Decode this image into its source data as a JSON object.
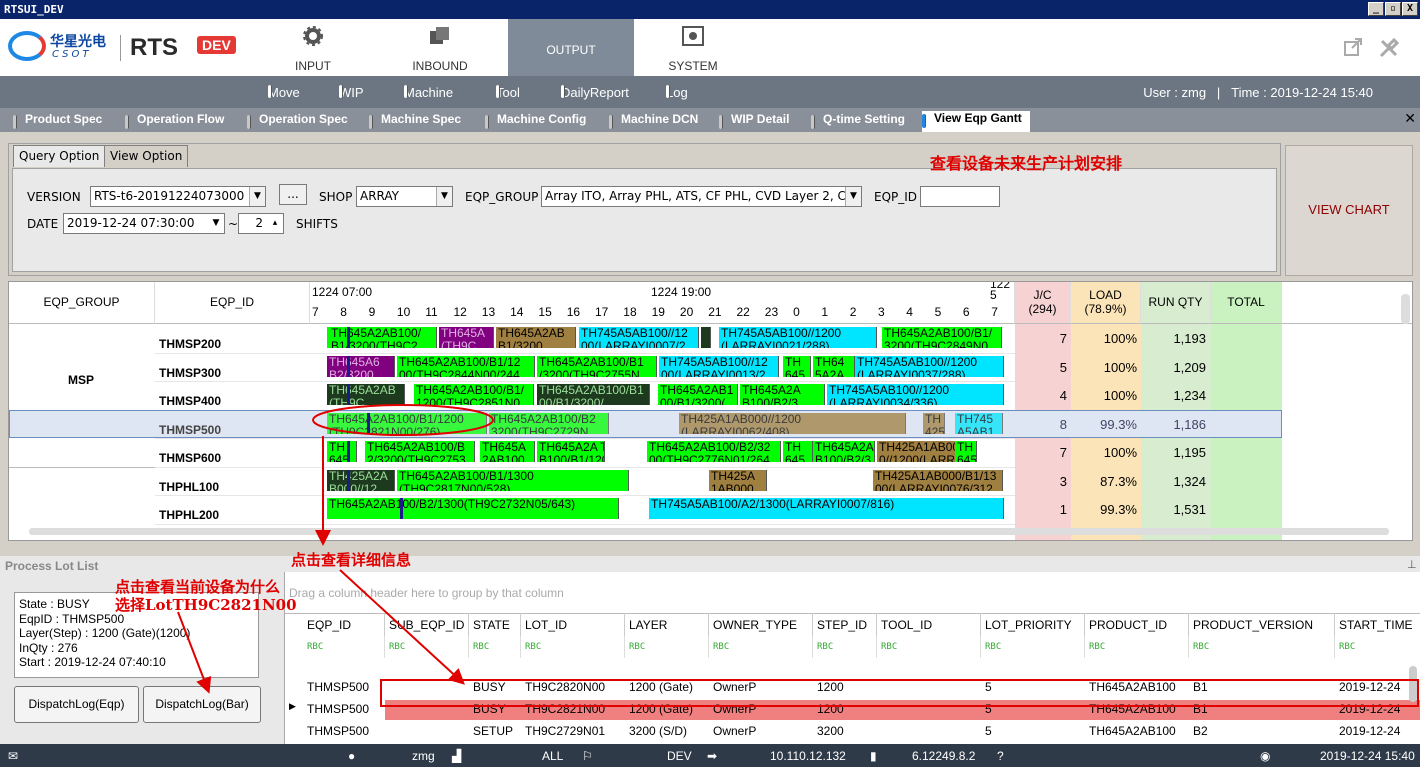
{
  "window": {
    "title": "RTSUI_DEV",
    "buttons": [
      "_",
      "▫",
      "X"
    ]
  },
  "header": {
    "logo_cn": "华星光电",
    "logo_en": "CSOT",
    "app_name": "RTS",
    "env_badge": "DEV",
    "main_tabs": [
      {
        "label": "INPUT",
        "icon": "gear-icon"
      },
      {
        "label": "INBOUND",
        "icon": "boxes-icon"
      },
      {
        "label": "OUTPUT",
        "icon": "none",
        "active": true
      },
      {
        "label": "SYSTEM",
        "icon": "gear-icon"
      }
    ]
  },
  "subnav": {
    "items": [
      "Move",
      "WIP",
      "Machine",
      "Tool",
      "DailyReport",
      "Log"
    ],
    "user": "User : zmg",
    "time": "Time : 2019-12-24 15:40"
  },
  "page_tabs": [
    "Product Spec",
    "Operation Flow",
    "Operation Spec",
    "Machine Spec",
    "Machine Config",
    "Machine DCN",
    "WIP Detail",
    "Q-time Setting",
    "View Eqp Gantt"
  ],
  "query": {
    "tabs": [
      "Query Option",
      "View Option"
    ],
    "version_label": "VERSION",
    "version_value": "RTS-t6-20191224073000",
    "browse_button": "...",
    "shop_label": "SHOP",
    "shop_value": "ARRAY",
    "eqp_group_label": "EQP_GROUP",
    "eqp_group_value": "Array ITO, Array PHL, ATS, CF PHL, CVD Layer 2, C'",
    "eqp_id_label": "EQP_ID",
    "eqp_id_value": "",
    "date_label": "DATE",
    "date_value": "2019-12-24 07:30:00",
    "tilde": "~",
    "shifts_value": "2",
    "shifts_label": "SHIFTS",
    "note": "查看设备未来生产计划安排"
  },
  "view_chart_button": "VIEW CHART",
  "gantt": {
    "col_group": "EQP_GROUP",
    "col_id": "EQP_ID",
    "day1": "1224 07:00",
    "day2": "1224 19:00",
    "day3": "122\n5",
    "hours": [
      "7",
      "8",
      "9",
      "10",
      "11",
      "12",
      "13",
      "14",
      "15",
      "16",
      "17",
      "18",
      "19",
      "20",
      "21",
      "22",
      "23",
      "0",
      "1",
      "2",
      "3",
      "4",
      "5",
      "6",
      "7"
    ],
    "jc_head": "J/C\n(294)",
    "load_head": "LOAD\n(78.9%)",
    "qty_head": "RUN QTY",
    "total_head": "TOTAL",
    "group_msp": "MSP",
    "rows": [
      {
        "eqp": "THMSP200",
        "jc": "7",
        "load": "100%",
        "qty": "1,193"
      },
      {
        "eqp": "THMSP300",
        "jc": "5",
        "load": "100%",
        "qty": "1,209"
      },
      {
        "eqp": "THMSP400",
        "jc": "4",
        "load": "100%",
        "qty": "1,234"
      },
      {
        "eqp": "THMSP500",
        "jc": "8",
        "load": "99.3%",
        "qty": "1,186",
        "selected": true
      },
      {
        "eqp": "THMSP600",
        "jc": "7",
        "load": "100%",
        "qty": "1,195"
      },
      {
        "eqp": "THPHL100",
        "jc": "3",
        "load": "87.3%",
        "qty": "1,324"
      },
      {
        "eqp": "THPHL200",
        "jc": "1",
        "load": "99.3%",
        "qty": "1,531"
      }
    ],
    "bars": {
      "r0": [
        "TH645A2AB100/\nB1/3200(TH9C2",
        "TH645A\n(TH9C",
        "TH645A2AB\nB1/3200",
        "TH745A5AB100//12\n00(LARRAYI0007/2",
        "TH745A5AB100//1200\n(LARRAYI0021/288)",
        "TH645A2AB100/B1/\n3200(TH9C2849N0"
      ],
      "r1": [
        "TH645A6\nB2/3200",
        "TH645A2AB100/B1/12\n00(TH9C2844N00/244",
        "TH645A2AB100/B1\n/3200(TH9C2755N",
        "TH745A5AB100//12\n00(LARRAYI0013/2",
        "TH\n645",
        "TH64\n5A2A",
        "TH745A5AB100//1200\n(LARRAYI0037/288)"
      ],
      "r2": [
        "TH645A2AB\n(TH9C",
        "TH645A2AB100/B1/\n1200(TH9C2851N0",
        "TH645A2AB100/B1\n00/B1/3200/",
        "TH645A2AB1\n00/B1/3200(",
        "TH645A2A\nB100/B2/3",
        "TH745A5AB100//1200\n(LARRAYI0034/336)"
      ],
      "r3": [
        "TH645A2AB100/B1/1200\n(TH9C2821N00/276)",
        "TH645A2AB100/B2\n3200(TH9C2729N",
        "TH425A1AB000//1200\n(LARRAYI0062/408)",
        "TH\n425",
        "TH745\nA5AB1"
      ],
      "r4": [
        "TH\n645",
        "TH645A2AB100/B\n2/3200(TH9C2753",
        "TH645A\n2AB100",
        "TH645A2A T\nB100/B1/120 H",
        "TH645A2AB100/B2/32\n00(TH9C2776N01/264",
        "TH\n645",
        "TH645A2A\nB100/B2/3",
        "TH425A1AB00\n0//1200(LARR",
        "TH\n645"
      ],
      "r5": [
        "TH425A2A\nB000//12",
        "TH645A2AB100/B1/1300\n(TH9C2817N00/528)",
        "TH425A\n1AB000",
        "TH425A1AB000/B1/13\n00(LARRAYI0076/312"
      ],
      "r6": [
        "TH645A2AB100/B2/1300(TH9C2732N05/643)",
        "TH745A5AB100/A2/1300(LARRAYI0007/816)"
      ]
    }
  },
  "lot_panel": {
    "title": "Process Lot List",
    "info": [
      "State : BUSY",
      "EqpID : THMSP500",
      "Layer(Step) : 1200 (Gate)(1200)",
      "InQty : 276",
      "Start : 2019-12-24 07:40:10"
    ],
    "btn_eqp": "DispatchLog(Eqp)",
    "btn_bar": "DispatchLog(Bar)",
    "group_hint": "Drag a column header here to group by that column",
    "columns": [
      "EQP_ID",
      "SUB_EQP_ID",
      "STATE",
      "LOT_ID",
      "LAYER",
      "OWNER_TYPE",
      "STEP_ID",
      "TOOL_ID",
      "LOT_PRIORITY",
      "PRODUCT_ID",
      "PRODUCT_VERSION",
      "START_TIME"
    ],
    "filter_glyph": "RBC",
    "rows": [
      [
        "THMSP500",
        "",
        "BUSY",
        "TH9C2820N00",
        "1200 (Gate)",
        "OwnerP",
        "1200",
        "",
        "5",
        "TH645A2AB100",
        "B1",
        "2019-12-24"
      ],
      [
        "THMSP500",
        "",
        "BUSY",
        "TH9C2821N00",
        "1200 (Gate)",
        "OwnerP",
        "1200",
        "",
        "5",
        "TH645A2AB100",
        "B1",
        "2019-12-24"
      ],
      [
        "THMSP500",
        "",
        "SETUP",
        "TH9C2729N01",
        "3200 (S/D)",
        "OwnerP",
        "3200",
        "",
        "5",
        "TH645A2AB100",
        "B2",
        "2019-12-24"
      ]
    ]
  },
  "annotations": {
    "a1": "点击查看当前设备为什么",
    "a2": "选择LotTH9C2821N00",
    "a3": "点击查看详细信息"
  },
  "statusbar": {
    "user": "zmg",
    "scope": "ALL",
    "env": "DEV",
    "ip": "10.110.12.132",
    "version": "6.12249.8.2",
    "datetime": "2019-12-24 15:40"
  },
  "colors": {
    "green": "#00ff00",
    "dark": "#1e3a1e",
    "purple": "#800080",
    "cyan": "#00e5ff",
    "khaki": "#a08040",
    "selected_row": "#f08080",
    "annotation": "#e00000"
  }
}
